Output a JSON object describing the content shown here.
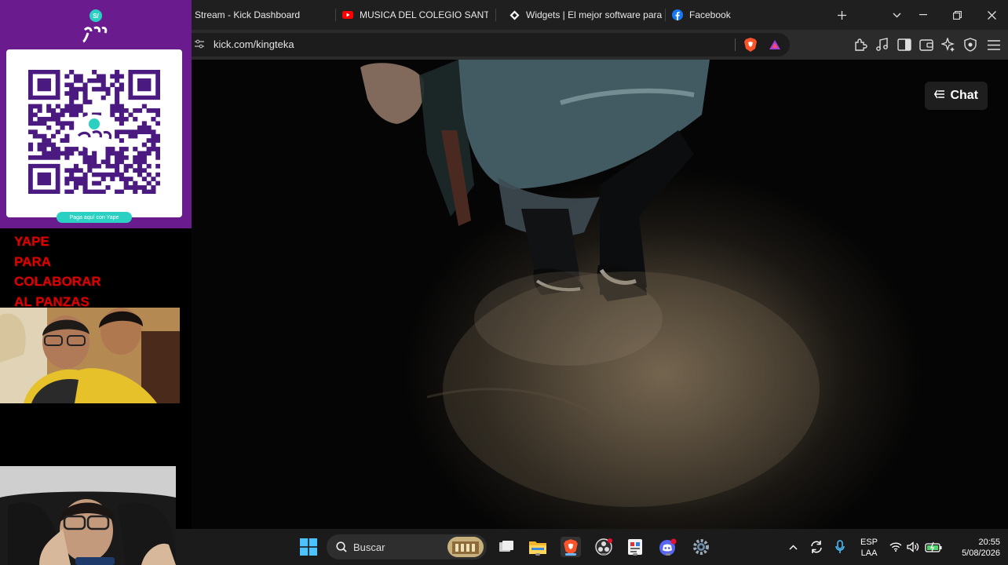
{
  "browser": {
    "tabs": [
      {
        "label": "Stream - Kick Dashboard",
        "icon": "kick-icon"
      },
      {
        "label": "MUSICA DEL COLEGIO SANTA M",
        "icon": "youtube-icon"
      },
      {
        "label": "Widgets | El mejor software para",
        "icon": "widgets-icon"
      },
      {
        "label": "Facebook",
        "icon": "facebook-icon"
      }
    ],
    "url": "kick.com/kingteka"
  },
  "stream": {
    "chat_label": "Chat"
  },
  "overlay": {
    "pay_label": "Paga aquí con Yape",
    "promo_lines": [
      "YAPE",
      "PARA",
      "COLABORAR",
      "AL PANZAS"
    ]
  },
  "taskbar": {
    "search_placeholder": "Buscar",
    "lang_top": "ESP",
    "lang_bottom": "LAA",
    "time": "20:55",
    "date": "5/08/2026"
  },
  "colors": {
    "yape_purple": "#6a1b8e",
    "promo_red": "#e00000",
    "accent_teal": "#2ad0c2"
  }
}
